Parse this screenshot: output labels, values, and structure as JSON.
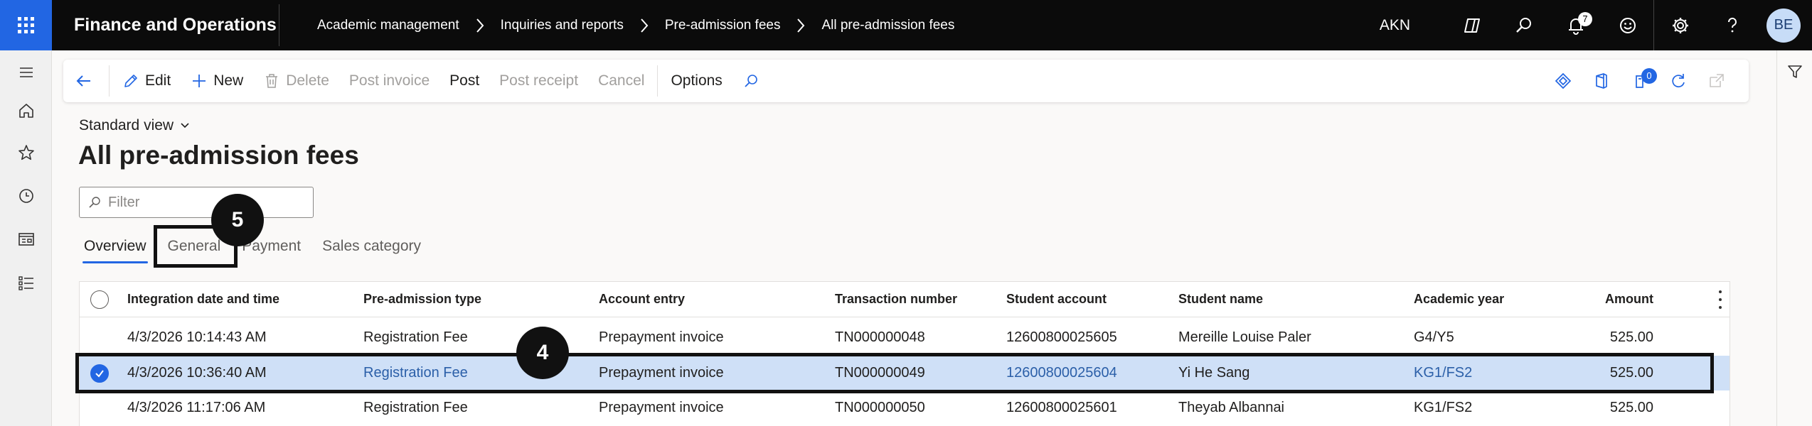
{
  "topbar": {
    "app_title": "Finance and Operations",
    "breadcrumb": [
      "Academic management",
      "Inquiries and reports",
      "Pre-admission fees",
      "All pre-admission fees"
    ],
    "company": "AKN",
    "notification_count": "7",
    "avatar_initials": "BE"
  },
  "actionpane": {
    "edit": "Edit",
    "new": "New",
    "delete": "Delete",
    "post_invoice": "Post invoice",
    "post": "Post",
    "post_receipt": "Post receipt",
    "cancel": "Cancel",
    "options": "Options",
    "attachments_count": "0"
  },
  "page": {
    "view": "Standard view",
    "title": "All pre-admission fees",
    "filter_placeholder": "Filter"
  },
  "tabs": [
    "Overview",
    "General",
    "Payment",
    "Sales category"
  ],
  "grid": {
    "columns": [
      "Integration date and time",
      "Pre-admission type",
      "Account entry",
      "Transaction number",
      "Student account",
      "Student name",
      "Academic year",
      "Amount"
    ],
    "rows": [
      {
        "date": "4/3/2026 10:14:43 AM",
        "type": "Registration Fee",
        "entry": "Prepayment invoice",
        "txn": "TN000000048",
        "account": "12600800025605",
        "name": "Mereille Louise Paler",
        "year": "G4/Y5",
        "amount": "525.00",
        "selected": false
      },
      {
        "date": "4/3/2026 10:36:40 AM",
        "type": "Registration Fee",
        "entry": "Prepayment invoice",
        "txn": "TN000000049",
        "account": "12600800025604",
        "name": "Yi He Sang",
        "year": "KG1/FS2",
        "amount": "525.00",
        "selected": true
      },
      {
        "date": "4/3/2026 11:17:06 AM",
        "type": "Registration Fee",
        "entry": "Prepayment invoice",
        "txn": "TN000000050",
        "account": "12600800025601",
        "name": "Theyab Albannai",
        "year": "KG1/FS2",
        "amount": "525.00",
        "selected": false
      }
    ]
  },
  "callouts": {
    "marker_tab": "5",
    "marker_row": "4"
  },
  "colors": {
    "topbar": "#0b0b0b",
    "accent": "#2266e3",
    "selected_row": "#cfe0f7",
    "link": "#2b5fa8"
  }
}
